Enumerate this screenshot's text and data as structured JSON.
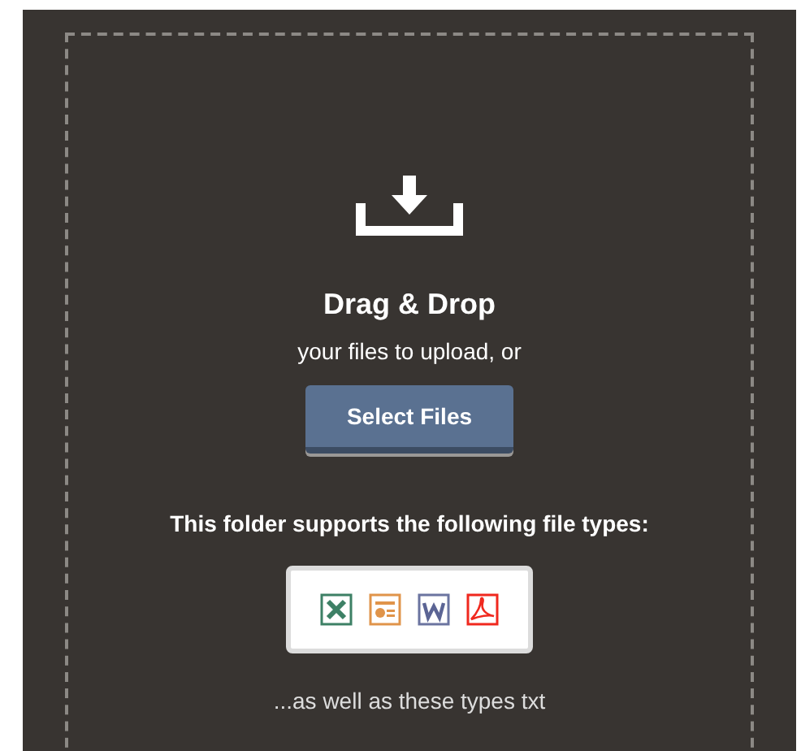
{
  "dropzone": {
    "title": "Drag & Drop",
    "subtitle": "your files to upload, or",
    "button": "Select Files",
    "supported_label": "This folder supports the following file types:",
    "file_types": [
      {
        "kind": "spreadsheet"
      },
      {
        "kind": "presentation"
      },
      {
        "kind": "document"
      },
      {
        "kind": "pdf"
      }
    ],
    "extra_types": "...as well as these types txt"
  }
}
